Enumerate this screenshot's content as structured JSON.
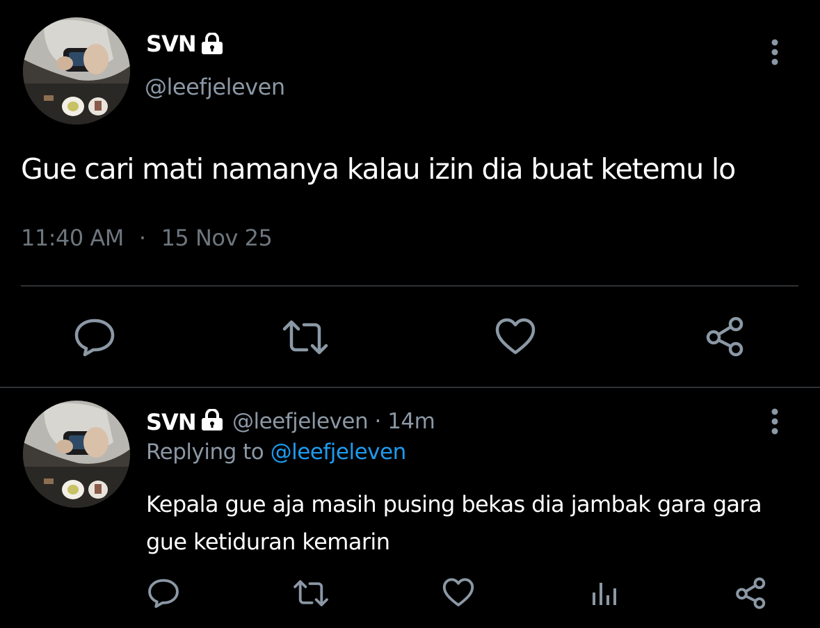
{
  "main_tweet": {
    "author": {
      "display_name": "SVN",
      "handle": "@leefjeleven",
      "protected_icon": "lock-icon",
      "avatar_icon": "avatar"
    },
    "text": "Gue cari mati namanya kalau izin dia buat ketemu lo",
    "time": "11:40 AM",
    "separator": "·",
    "date": "15 Nov 25",
    "actions": [
      "reply-icon",
      "retweet-icon",
      "like-icon",
      "share-icon"
    ],
    "more_icon": "more-vertical-icon"
  },
  "reply_tweet": {
    "author": {
      "display_name": "SVN",
      "handle": "@leefjeleven",
      "protected_icon": "lock-icon",
      "avatar_icon": "avatar"
    },
    "meta_separator": "·",
    "age": "14m",
    "replying_prefix": "Replying to ",
    "replying_to": "@leefjeleven",
    "text": "Kepala gue aja masih pusing bekas dia jambak gara gara gue ketiduran kemarin",
    "actions": [
      "reply-icon",
      "retweet-icon",
      "like-icon",
      "analytics-icon",
      "share-icon"
    ],
    "more_icon": "more-vertical-icon"
  },
  "colors": {
    "background": "#000000",
    "primary_text": "#ffffff",
    "secondary_text": "#8b98a5",
    "timestamp_text": "#6e767d",
    "link": "#1d9bf0",
    "divider": "#2f3336",
    "icon": "#8b98a5"
  }
}
